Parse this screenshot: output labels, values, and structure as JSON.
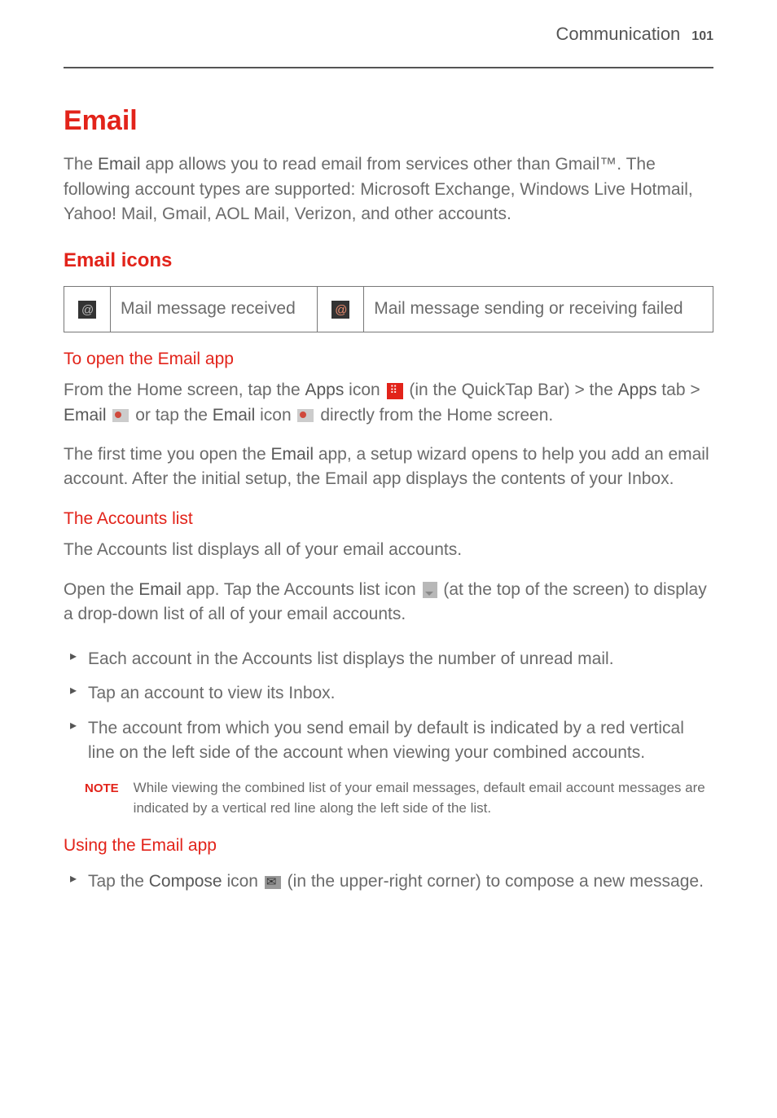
{
  "header": {
    "section": "Communication",
    "pageNumber": "101"
  },
  "title": "Email",
  "intro": {
    "prefix": "The ",
    "appName": "Email",
    "rest": " app allows you to read email from services other than Gmail™. The following account types are supported: Microsoft Exchange, Windows Live Hotmail, Yahoo! Mail, Gmail, AOL Mail, Verizon, and other accounts."
  },
  "emailIcons": {
    "heading": "Email icons",
    "row1": "Mail message received",
    "row2": "Mail message sending or receiving failed"
  },
  "openApp": {
    "heading": "To open the Email app",
    "p1_a": "From the Home screen, tap the ",
    "p1_b_bold": "Apps",
    "p1_c": " icon ",
    "p1_d": " (in the QuickTap Bar) > the ",
    "p1_e_bold": "Apps",
    "p1_f": " tab > ",
    "p1_g_bold": "Email",
    "p1_h": " or tap the ",
    "p1_i_bold": "Email",
    "p1_j": " icon ",
    "p1_k": " directly from the Home screen.",
    "p2_a": "The first time you open the ",
    "p2_b_bold": "Email",
    "p2_c": " app, a setup wizard opens to help you add an email account. After the initial setup, the Email app displays the contents of your Inbox."
  },
  "accounts": {
    "heading": "The Accounts list",
    "p1": "The Accounts list displays all of your email accounts.",
    "p2_a": "Open the ",
    "p2_b_bold": "Email",
    "p2_c": " app. Tap the Accounts list icon ",
    "p2_d": " (at the top of the screen) to display a drop-down list of all of your email accounts.",
    "bullets": [
      "Each account in the Accounts list displays the number of unread mail.",
      "Tap an account to view its Inbox.",
      "The account from which you send email by default is indicated by a red vertical line on the left side of the account when viewing your combined accounts."
    ],
    "noteLabel": "NOTE",
    "noteText": "While viewing the combined list of your email messages, default email account messages are indicated by a vertical red line along the left side of the list."
  },
  "using": {
    "heading": "Using the Email app",
    "b1_a": "Tap the ",
    "b1_b_bold": "Compose",
    "b1_c": " icon ",
    "b1_d": " (in the upper-right corner) to compose a new message."
  }
}
